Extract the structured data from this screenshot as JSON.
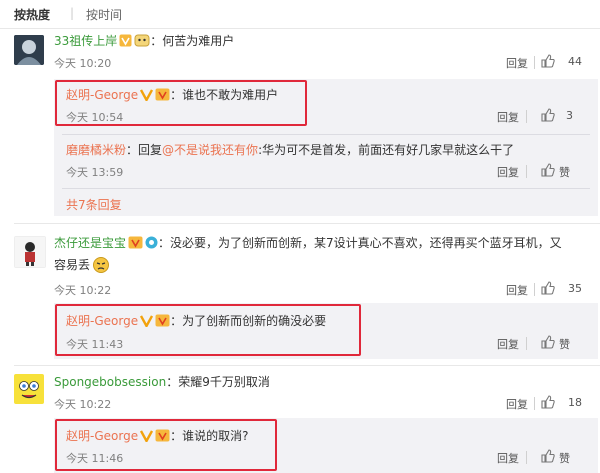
{
  "tabs": {
    "hot": "按热度",
    "sep": "|",
    "time": "按时间"
  },
  "actions": {
    "reply": "回复",
    "like": "赞"
  },
  "comments": [
    {
      "user": "33祖传上岸",
      "colon": "：",
      "text": "何苦为难用户",
      "time": "今天 10:20",
      "likes": "44",
      "replies": [
        {
          "user": "赵明-George",
          "colon": "：",
          "text": "谁也不敢为难用户",
          "time": "今天 10:54",
          "likes": "3"
        },
        {
          "user": "磨磨橘米粉",
          "colon": "：",
          "prefix": "回复",
          "mention": "@不是说我还有你",
          "text": ":华为可不是首发，前面还有好几家早就这么干了",
          "time": "今天 13:59",
          "likes": "赞"
        }
      ],
      "more": "共7条回复"
    },
    {
      "user": "杰仔还是宝宝",
      "colon": "：",
      "text_line1": "没必要，为了创新而创新，某7设计真心不喜欢，还得再买个蓝牙耳机，又",
      "text_line2": "容易丢",
      "time": "今天 10:22",
      "likes": "35",
      "replies": [
        {
          "user": "赵明-George",
          "colon": "：",
          "text": "为了创新而创新的确没必要",
          "time": "今天 11:43",
          "likes": "赞"
        }
      ]
    },
    {
      "user": "Spongebobsession",
      "colon": "：",
      "text": "荣耀9千万别取消",
      "time": "今天 10:22",
      "likes": "18",
      "replies": [
        {
          "user": "赵明-George",
          "colon": "：",
          "text": "谁说的取消?",
          "time": "今天 11:46",
          "likes": "赞"
        }
      ]
    }
  ],
  "colors": {
    "name": "#eb7350",
    "highlight": "#e0283a",
    "reply_bg": "#f2f2f5"
  }
}
